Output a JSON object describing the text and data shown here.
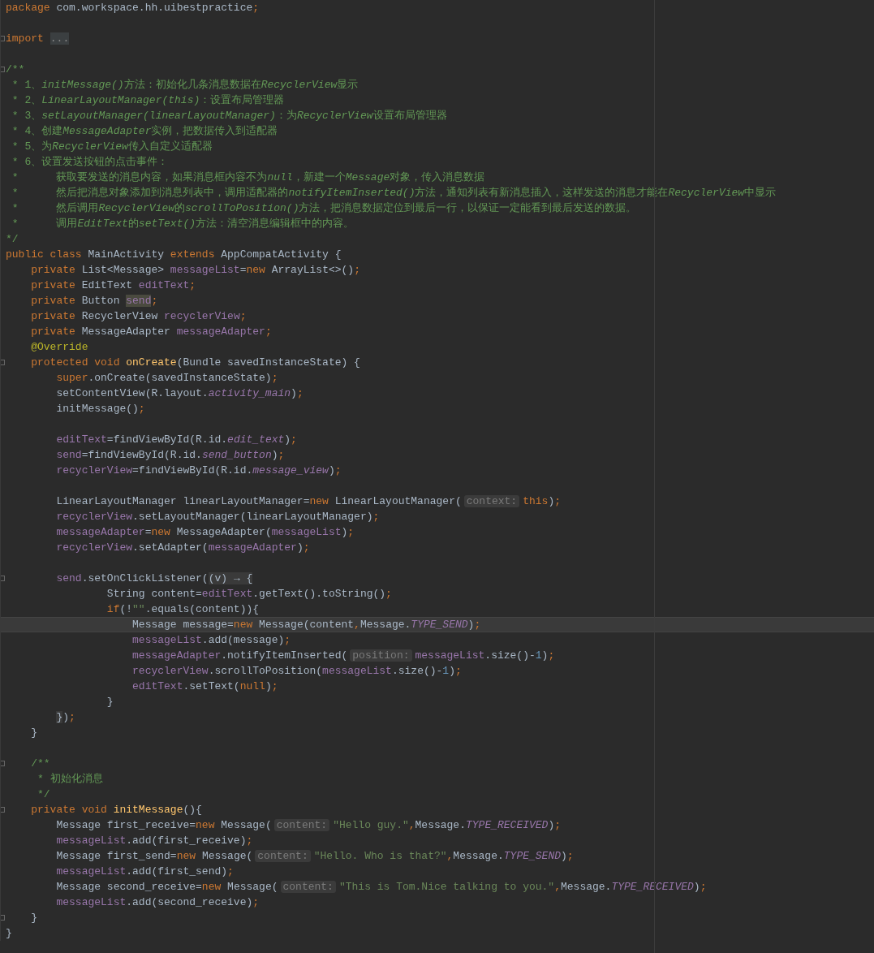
{
  "editor": {
    "lines": [
      {
        "current": false,
        "fold_marker": false,
        "tokens": [
          {
            "kind": "keyword",
            "text": "package"
          },
          {
            "kind": "plain",
            "text": " com.workspace.hh.uibestpractice"
          },
          {
            "kind": "keyword",
            "text": ";"
          }
        ]
      },
      {
        "current": false,
        "fold_marker": false
      },
      {
        "current": false,
        "fold_marker": true,
        "tokens": [
          {
            "kind": "keyword",
            "text": "import"
          },
          {
            "kind": "folded",
            "text": "..."
          }
        ]
      },
      {
        "current": false,
        "fold_marker": false
      },
      {
        "current": false,
        "fold_marker": true,
        "tokens": [
          {
            "kind": "doc",
            "text": "/**"
          }
        ]
      },
      {
        "current": false,
        "fold_marker": false,
        "tokens": [
          {
            "kind": "doc",
            "text": " * 1、"
          },
          {
            "kind": "doc_code",
            "text": "initMessage()"
          },
          {
            "kind": "doc",
            "text": "方法：初始化几条消息数据在"
          },
          {
            "kind": "doc_code",
            "text": "RecyclerView"
          },
          {
            "kind": "doc",
            "text": "显示"
          }
        ]
      },
      {
        "current": false,
        "fold_marker": false,
        "tokens": [
          {
            "kind": "doc",
            "text": " * 2、"
          },
          {
            "kind": "doc_code",
            "text": "LinearLayoutManager(this)"
          },
          {
            "kind": "doc",
            "text": "：设置布局管理器"
          }
        ]
      },
      {
        "current": false,
        "fold_marker": false,
        "tokens": [
          {
            "kind": "doc",
            "text": " * 3、"
          },
          {
            "kind": "doc_code",
            "text": "setLayoutManager(linearLayoutManager)"
          },
          {
            "kind": "doc",
            "text": "：为"
          },
          {
            "kind": "doc_code",
            "text": "RecyclerView"
          },
          {
            "kind": "doc",
            "text": "设置布局管理器"
          }
        ]
      },
      {
        "current": false,
        "fold_marker": false,
        "tokens": [
          {
            "kind": "doc",
            "text": " * 4、创建"
          },
          {
            "kind": "doc_code",
            "text": "MessageAdapter"
          },
          {
            "kind": "doc",
            "text": "实例，把数据传入到适配器"
          }
        ]
      },
      {
        "current": false,
        "fold_marker": false,
        "tokens": [
          {
            "kind": "doc",
            "text": " * 5、为"
          },
          {
            "kind": "doc_code",
            "text": "RecyclerView"
          },
          {
            "kind": "doc",
            "text": "传入自定义适配器"
          }
        ]
      },
      {
        "current": false,
        "fold_marker": false,
        "tokens": [
          {
            "kind": "doc",
            "text": " * 6、设置发送按钮的点击事件："
          }
        ]
      },
      {
        "current": false,
        "fold_marker": false,
        "tokens": [
          {
            "kind": "doc",
            "text": " *      获取要发送的消息内容，如果消息框内容不为"
          },
          {
            "kind": "doc_code",
            "text": "null"
          },
          {
            "kind": "doc",
            "text": "，新建一个"
          },
          {
            "kind": "doc_code",
            "text": "Message"
          },
          {
            "kind": "doc",
            "text": "对象，传入消息数据"
          }
        ]
      },
      {
        "current": false,
        "fold_marker": false,
        "tokens": [
          {
            "kind": "doc",
            "text": " *      然后把消息对象添加到消息列表中，调用适配器的"
          },
          {
            "kind": "doc_code",
            "text": "notifyItemInserted()"
          },
          {
            "kind": "doc",
            "text": "方法，通知列表有新消息插入，这样发送的消息才能在"
          },
          {
            "kind": "doc_code",
            "text": "RecyclerView"
          },
          {
            "kind": "doc",
            "text": "中显示"
          }
        ]
      },
      {
        "current": false,
        "fold_marker": false,
        "tokens": [
          {
            "kind": "doc",
            "text": " *      然后调用"
          },
          {
            "kind": "doc_code",
            "text": "RecyclerView"
          },
          {
            "kind": "doc",
            "text": "的"
          },
          {
            "kind": "doc_code",
            "text": "scrollToPosition()"
          },
          {
            "kind": "doc",
            "text": "方法，把消息数据定位到最后一行，以保证一定能看到最后发送的数据。"
          }
        ]
      },
      {
        "current": false,
        "fold_marker": false,
        "tokens": [
          {
            "kind": "doc",
            "text": " *      调用"
          },
          {
            "kind": "doc_code",
            "text": "EditText"
          },
          {
            "kind": "doc",
            "text": "的"
          },
          {
            "kind": "doc_code",
            "text": "setText()"
          },
          {
            "kind": "doc",
            "text": "方法：清空消息编辑框中的内容。"
          }
        ]
      },
      {
        "current": false,
        "fold_marker": false,
        "tokens": [
          {
            "kind": "doc",
            "text": "*/"
          }
        ]
      },
      {
        "current": false,
        "fold_marker": false,
        "tokens": [
          {
            "kind": "keyword",
            "text": "public class "
          },
          {
            "kind": "plain",
            "text": "MainActivity "
          },
          {
            "kind": "keyword",
            "text": "extends "
          },
          {
            "kind": "plain",
            "text": "AppCompatActivity {"
          }
        ]
      },
      {
        "current": false,
        "fold_marker": false,
        "tokens": [
          {
            "kind": "keyword",
            "text": "    private "
          },
          {
            "kind": "plain",
            "text": "List<Message> "
          },
          {
            "kind": "field",
            "text": "messageList"
          },
          {
            "kind": "plain",
            "text": "="
          },
          {
            "kind": "keyword",
            "text": "new "
          },
          {
            "kind": "plain",
            "text": "ArrayList<>()"
          },
          {
            "kind": "keyword",
            "text": ";"
          }
        ]
      },
      {
        "current": false,
        "fold_marker": false,
        "tokens": [
          {
            "kind": "keyword",
            "text": "    private "
          },
          {
            "kind": "plain",
            "text": "EditText "
          },
          {
            "kind": "field",
            "text": "editText"
          },
          {
            "kind": "keyword",
            "text": ";"
          }
        ]
      },
      {
        "current": false,
        "fold_marker": false,
        "tokens": [
          {
            "kind": "keyword",
            "text": "    private "
          },
          {
            "kind": "plain",
            "text": "Button "
          },
          {
            "kind": "field_usage",
            "text": "send"
          },
          {
            "kind": "keyword",
            "text": ";"
          }
        ]
      },
      {
        "current": false,
        "fold_marker": false,
        "tokens": [
          {
            "kind": "keyword",
            "text": "    private "
          },
          {
            "kind": "plain",
            "text": "RecyclerView "
          },
          {
            "kind": "field",
            "text": "recyclerView"
          },
          {
            "kind": "keyword",
            "text": ";"
          }
        ]
      },
      {
        "current": false,
        "fold_marker": false,
        "tokens": [
          {
            "kind": "keyword",
            "text": "    private "
          },
          {
            "kind": "plain",
            "text": "MessageAdapter "
          },
          {
            "kind": "field",
            "text": "messageAdapter"
          },
          {
            "kind": "keyword",
            "text": ";"
          }
        ]
      },
      {
        "current": false,
        "fold_marker": false,
        "tokens": [
          {
            "kind": "annotation",
            "text": "    @Override"
          }
        ]
      },
      {
        "current": false,
        "fold_marker": true,
        "tokens": [
          {
            "kind": "keyword",
            "text": "    protected void "
          },
          {
            "kind": "method",
            "text": "onCreate"
          },
          {
            "kind": "plain",
            "text": "(Bundle savedInstanceState) {"
          }
        ]
      },
      {
        "current": false,
        "fold_marker": false,
        "tokens": [
          {
            "kind": "keyword",
            "text": "        super"
          },
          {
            "kind": "plain",
            "text": ".onCreate(savedInstanceState)"
          },
          {
            "kind": "keyword",
            "text": ";"
          }
        ]
      },
      {
        "current": false,
        "fold_marker": false,
        "tokens": [
          {
            "kind": "plain",
            "text": "        setContentView(R.layout."
          },
          {
            "kind": "constant",
            "text": "activity_main"
          },
          {
            "kind": "plain",
            "text": ")"
          },
          {
            "kind": "keyword",
            "text": ";"
          }
        ]
      },
      {
        "current": false,
        "fold_marker": false,
        "tokens": [
          {
            "kind": "plain",
            "text": "        initMessage()"
          },
          {
            "kind": "keyword",
            "text": ";"
          }
        ]
      },
      {
        "current": false,
        "fold_marker": false
      },
      {
        "current": false,
        "fold_marker": false,
        "tokens": [
          {
            "kind": "field",
            "text": "        editText"
          },
          {
            "kind": "plain",
            "text": "=findViewById(R.id."
          },
          {
            "kind": "constant",
            "text": "edit_text"
          },
          {
            "kind": "plain",
            "text": ")"
          },
          {
            "kind": "keyword",
            "text": ";"
          }
        ]
      },
      {
        "current": false,
        "fold_marker": false,
        "tokens": [
          {
            "kind": "field",
            "text": "        send"
          },
          {
            "kind": "plain",
            "text": "=findViewById(R.id."
          },
          {
            "kind": "constant",
            "text": "send_button"
          },
          {
            "kind": "plain",
            "text": ")"
          },
          {
            "kind": "keyword",
            "text": ";"
          }
        ]
      },
      {
        "current": false,
        "fold_marker": false,
        "tokens": [
          {
            "kind": "field",
            "text": "        recyclerView"
          },
          {
            "kind": "plain",
            "text": "=findViewById(R.id."
          },
          {
            "kind": "constant",
            "text": "message_view"
          },
          {
            "kind": "plain",
            "text": ")"
          },
          {
            "kind": "keyword",
            "text": ";"
          }
        ]
      },
      {
        "current": false,
        "fold_marker": false
      },
      {
        "current": false,
        "fold_marker": false,
        "tokens": [
          {
            "kind": "plain",
            "text": "        LinearLayoutManager linearLayoutManager="
          },
          {
            "kind": "keyword",
            "text": "new "
          },
          {
            "kind": "plain",
            "text": "LinearLayoutManager("
          },
          {
            "kind": "hint",
            "text": "context:"
          },
          {
            "kind": "keyword",
            "text": "this"
          },
          {
            "kind": "plain",
            "text": ")"
          },
          {
            "kind": "keyword",
            "text": ";"
          }
        ]
      },
      {
        "current": false,
        "fold_marker": false,
        "tokens": [
          {
            "kind": "field",
            "text": "        recyclerView"
          },
          {
            "kind": "plain",
            "text": ".setLayoutManager(linearLayoutManager)"
          },
          {
            "kind": "keyword",
            "text": ";"
          }
        ]
      },
      {
        "current": false,
        "fold_marker": false,
        "tokens": [
          {
            "kind": "field",
            "text": "        messageAdapter"
          },
          {
            "kind": "plain",
            "text": "="
          },
          {
            "kind": "keyword",
            "text": "new "
          },
          {
            "kind": "plain",
            "text": "MessageAdapter("
          },
          {
            "kind": "field",
            "text": "messageList"
          },
          {
            "kind": "plain",
            "text": ")"
          },
          {
            "kind": "keyword",
            "text": ";"
          }
        ]
      },
      {
        "current": false,
        "fold_marker": false,
        "tokens": [
          {
            "kind": "field",
            "text": "        recyclerView"
          },
          {
            "kind": "plain",
            "text": ".setAdapter("
          },
          {
            "kind": "field",
            "text": "messageAdapter"
          },
          {
            "kind": "plain",
            "text": ")"
          },
          {
            "kind": "keyword",
            "text": ";"
          }
        ]
      },
      {
        "current": false,
        "fold_marker": false
      },
      {
        "current": false,
        "fold_marker": true,
        "tokens": [
          {
            "kind": "field",
            "text": "        send"
          },
          {
            "kind": "plain",
            "text": ".setOnClickListener("
          },
          {
            "kind": "lambda",
            "text": "(v) → {"
          }
        ]
      },
      {
        "current": false,
        "fold_marker": false,
        "tokens": [
          {
            "kind": "plain",
            "text": "                String content="
          },
          {
            "kind": "field",
            "text": "editText"
          },
          {
            "kind": "plain",
            "text": ".getText().toString()"
          },
          {
            "kind": "keyword",
            "text": ";"
          }
        ]
      },
      {
        "current": false,
        "fold_marker": false,
        "tokens": [
          {
            "kind": "keyword",
            "text": "                if"
          },
          {
            "kind": "plain",
            "text": "(!"
          },
          {
            "kind": "string",
            "text": "\"\""
          },
          {
            "kind": "plain",
            "text": ".equals(content)){"
          }
        ]
      },
      {
        "current": true,
        "fold_marker": false,
        "tokens": [
          {
            "kind": "plain",
            "text": "                    Message message="
          },
          {
            "kind": "keyword",
            "text": "new "
          },
          {
            "kind": "plain",
            "text": "Message(content"
          },
          {
            "kind": "keyword",
            "text": ","
          },
          {
            "kind": "plain",
            "text": "Message."
          },
          {
            "kind": "constant",
            "text": "TYPE_SEND"
          },
          {
            "kind": "plain",
            "text": ")"
          },
          {
            "kind": "keyword",
            "text": ";"
          }
        ]
      },
      {
        "current": false,
        "fold_marker": false,
        "tokens": [
          {
            "kind": "field",
            "text": "                    messageList"
          },
          {
            "kind": "plain",
            "text": ".add(message)"
          },
          {
            "kind": "keyword",
            "text": ";"
          }
        ]
      },
      {
        "current": false,
        "fold_marker": false,
        "tokens": [
          {
            "kind": "field",
            "text": "                    messageAdapter"
          },
          {
            "kind": "plain",
            "text": ".notifyItemInserted("
          },
          {
            "kind": "hint",
            "text": "position:"
          },
          {
            "kind": "field",
            "text": "messageList"
          },
          {
            "kind": "plain",
            "text": ".size()-"
          },
          {
            "kind": "number",
            "text": "1"
          },
          {
            "kind": "plain",
            "text": ")"
          },
          {
            "kind": "keyword",
            "text": ";"
          }
        ]
      },
      {
        "current": false,
        "fold_marker": false,
        "tokens": [
          {
            "kind": "field",
            "text": "                    recyclerView"
          },
          {
            "kind": "plain",
            "text": ".scrollToPosition("
          },
          {
            "kind": "field",
            "text": "messageList"
          },
          {
            "kind": "plain",
            "text": ".size()-"
          },
          {
            "kind": "number",
            "text": "1"
          },
          {
            "kind": "plain",
            "text": ")"
          },
          {
            "kind": "keyword",
            "text": ";"
          }
        ]
      },
      {
        "current": false,
        "fold_marker": false,
        "tokens": [
          {
            "kind": "field",
            "text": "                    editText"
          },
          {
            "kind": "plain",
            "text": ".setText("
          },
          {
            "kind": "keyword",
            "text": "null"
          },
          {
            "kind": "plain",
            "text": ")"
          },
          {
            "kind": "keyword",
            "text": ";"
          }
        ]
      },
      {
        "current": false,
        "fold_marker": false,
        "tokens": [
          {
            "kind": "plain",
            "text": "                }"
          }
        ]
      },
      {
        "current": false,
        "fold_marker": false,
        "tokens": [
          {
            "kind": "lambda",
            "text": "        }"
          },
          {
            "kind": "plain",
            "text": ")"
          },
          {
            "kind": "keyword",
            "text": ";"
          }
        ]
      },
      {
        "current": false,
        "fold_marker": false,
        "tokens": [
          {
            "kind": "plain",
            "text": "    }"
          }
        ]
      },
      {
        "current": false,
        "fold_marker": false
      },
      {
        "current": false,
        "fold_marker": true,
        "tokens": [
          {
            "kind": "doc",
            "text": "    /**"
          }
        ]
      },
      {
        "current": false,
        "fold_marker": false,
        "tokens": [
          {
            "kind": "doc",
            "text": "     * 初始化消息"
          }
        ]
      },
      {
        "current": false,
        "fold_marker": false,
        "tokens": [
          {
            "kind": "doc",
            "text": "     */"
          }
        ]
      },
      {
        "current": false,
        "fold_marker": true,
        "tokens": [
          {
            "kind": "keyword",
            "text": "    private void "
          },
          {
            "kind": "method",
            "text": "initMessage"
          },
          {
            "kind": "plain",
            "text": "(){"
          }
        ]
      },
      {
        "current": false,
        "fold_marker": false,
        "tokens": [
          {
            "kind": "plain",
            "text": "        Message first_receive="
          },
          {
            "kind": "keyword",
            "text": "new "
          },
          {
            "kind": "plain",
            "text": "Message("
          },
          {
            "kind": "hint",
            "text": "content:"
          },
          {
            "kind": "string",
            "text": "\"Hello guy.\""
          },
          {
            "kind": "keyword",
            "text": ","
          },
          {
            "kind": "plain",
            "text": "Message."
          },
          {
            "kind": "constant",
            "text": "TYPE_RECEIVED"
          },
          {
            "kind": "plain",
            "text": ")"
          },
          {
            "kind": "keyword",
            "text": ";"
          }
        ]
      },
      {
        "current": false,
        "fold_marker": false,
        "tokens": [
          {
            "kind": "field",
            "text": "        messageList"
          },
          {
            "kind": "plain",
            "text": ".add(first_receive)"
          },
          {
            "kind": "keyword",
            "text": ";"
          }
        ]
      },
      {
        "current": false,
        "fold_marker": false,
        "tokens": [
          {
            "kind": "plain",
            "text": "        Message first_send="
          },
          {
            "kind": "keyword",
            "text": "new "
          },
          {
            "kind": "plain",
            "text": "Message("
          },
          {
            "kind": "hint",
            "text": "content:"
          },
          {
            "kind": "string",
            "text": "\"Hello. Who is that?\""
          },
          {
            "kind": "keyword",
            "text": ","
          },
          {
            "kind": "plain",
            "text": "Message."
          },
          {
            "kind": "constant",
            "text": "TYPE_SEND"
          },
          {
            "kind": "plain",
            "text": ")"
          },
          {
            "kind": "keyword",
            "text": ";"
          }
        ]
      },
      {
        "current": false,
        "fold_marker": false,
        "tokens": [
          {
            "kind": "field",
            "text": "        messageList"
          },
          {
            "kind": "plain",
            "text": ".add(first_send)"
          },
          {
            "kind": "keyword",
            "text": ";"
          }
        ]
      },
      {
        "current": false,
        "fold_marker": false,
        "tokens": [
          {
            "kind": "plain",
            "text": "        Message second_receive="
          },
          {
            "kind": "keyword",
            "text": "new "
          },
          {
            "kind": "plain",
            "text": "Message("
          },
          {
            "kind": "hint",
            "text": "content:"
          },
          {
            "kind": "string",
            "text": "\"This is Tom.Nice talking to you.\""
          },
          {
            "kind": "keyword",
            "text": ","
          },
          {
            "kind": "plain",
            "text": "Message."
          },
          {
            "kind": "constant",
            "text": "TYPE_RECEIVED"
          },
          {
            "kind": "plain",
            "text": ")"
          },
          {
            "kind": "keyword",
            "text": ";"
          }
        ]
      },
      {
        "current": false,
        "fold_marker": false,
        "tokens": [
          {
            "kind": "field",
            "text": "        messageList"
          },
          {
            "kind": "plain",
            "text": ".add(second_receive)"
          },
          {
            "kind": "keyword",
            "text": ";"
          }
        ]
      },
      {
        "current": false,
        "fold_marker": true,
        "tokens": [
          {
            "kind": "plain",
            "text": "    }"
          }
        ]
      },
      {
        "current": false,
        "fold_marker": false,
        "tokens": [
          {
            "kind": "plain",
            "text": "}"
          }
        ]
      }
    ]
  }
}
